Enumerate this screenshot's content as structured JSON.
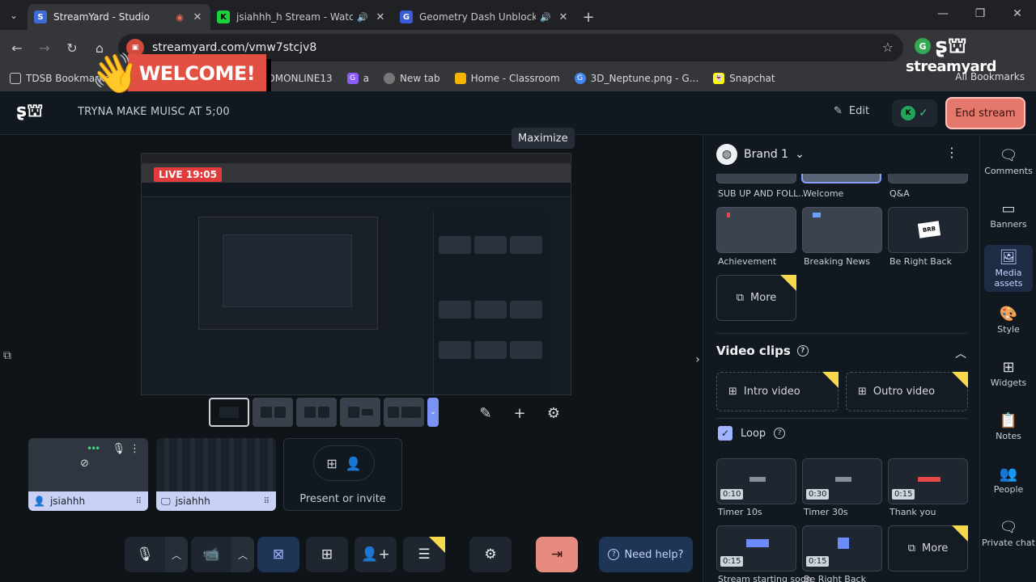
{
  "browser": {
    "tabs": [
      {
        "title": "StreamYard - Studio",
        "active": true,
        "fav_color": "#3e6bd6",
        "fav": "S",
        "indicator": "●"
      },
      {
        "title": "jsiahhh_h Stream - Watch Liv",
        "active": false,
        "fav_color": "#1bd13b",
        "fav": "K",
        "indicator": "🔊"
      },
      {
        "title": "Geometry Dash Unblocked",
        "active": false,
        "fav_color": "#3b5bd6",
        "fav": "G",
        "indicator": "🔊"
      }
    ],
    "url": "streamyard.com/vmw7stcjv8",
    "bookmarks": [
      {
        "label": "TDSB Bookmarks",
        "color": "#5f6368"
      },
      {
        "label": "PDMONLINE13",
        "color": "#d33"
      },
      {
        "label": "a",
        "color": "#8a5cf6"
      },
      {
        "label": "New tab",
        "color": "#777"
      },
      {
        "label": "Home - Classroom",
        "color": "#f4b400"
      },
      {
        "label": "3D_Neptune.png - G...",
        "color": "#4285f4"
      },
      {
        "label": "Snapchat",
        "color": "#fffc00"
      }
    ],
    "all_bookmarks": "All Bookmarks"
  },
  "overlay": {
    "welcome": "WELCOME!",
    "watermark": "streamyard"
  },
  "studio": {
    "title": "TRYNA MAKE MUISC AT 5;00",
    "edit": "Edit",
    "avatar_initial": "K",
    "end_stream": "End stream",
    "maximize": "Maximize",
    "live_badge": "LIVE 19:05"
  },
  "participants": [
    {
      "name": "jsiahhh",
      "type": "camera"
    },
    {
      "name": "jsiahhh",
      "type": "screen"
    }
  ],
  "present": {
    "label": "Present or invite"
  },
  "controls": {
    "help": "Need help?"
  },
  "panel": {
    "brand": "Brand 1",
    "top_captions": [
      "SUB UP AND FOLL...",
      "Welcome",
      "Q&A"
    ],
    "overlays": [
      {
        "label": "Achievement"
      },
      {
        "label": "Breaking News"
      },
      {
        "label": "Be Right Back"
      }
    ],
    "brb_text": "BRB",
    "more": "More",
    "video_clips_title": "Video clips",
    "intro_video": "Intro video",
    "outro_video": "Outro video",
    "loop": "Loop",
    "clips": [
      {
        "label": "Timer 10s",
        "duration": "0:10"
      },
      {
        "label": "Timer 30s",
        "duration": "0:30"
      },
      {
        "label": "Thank you",
        "duration": "0:15"
      },
      {
        "label": "Stream starting soon",
        "duration": "0:15"
      },
      {
        "label": "Be Right Back",
        "duration": "0:15"
      }
    ]
  },
  "rail": [
    {
      "label": "Comments",
      "icon": "💬"
    },
    {
      "label": "Banners",
      "icon": "▭"
    },
    {
      "label": "Media assets",
      "icon": "🖼"
    },
    {
      "label": "Style",
      "icon": "🎨"
    },
    {
      "label": "Widgets",
      "icon": "⊞"
    },
    {
      "label": "Notes",
      "icon": "📋"
    },
    {
      "label": "People",
      "icon": "👥"
    },
    {
      "label": "Private chat",
      "icon": "🗨"
    }
  ]
}
